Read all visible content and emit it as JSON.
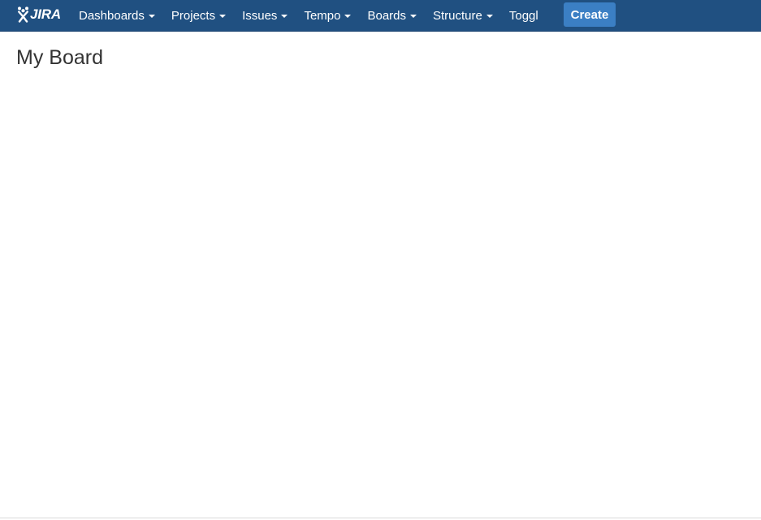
{
  "header": {
    "logo": {
      "icon": "jira-logo-icon",
      "text": "JIRA"
    },
    "nav": [
      {
        "label": "Dashboards",
        "has_dropdown": true
      },
      {
        "label": "Projects",
        "has_dropdown": true
      },
      {
        "label": "Issues",
        "has_dropdown": true
      },
      {
        "label": "Tempo",
        "has_dropdown": true
      },
      {
        "label": "Boards",
        "has_dropdown": true
      },
      {
        "label": "Structure",
        "has_dropdown": true
      },
      {
        "label": "Toggl",
        "has_dropdown": false
      }
    ],
    "create_label": "Create"
  },
  "main": {
    "title": "My Board"
  },
  "colors": {
    "header_bg": "#205081",
    "create_button_bg": "#3b7fc4",
    "title_text": "#333333",
    "background": "#ffffff"
  }
}
